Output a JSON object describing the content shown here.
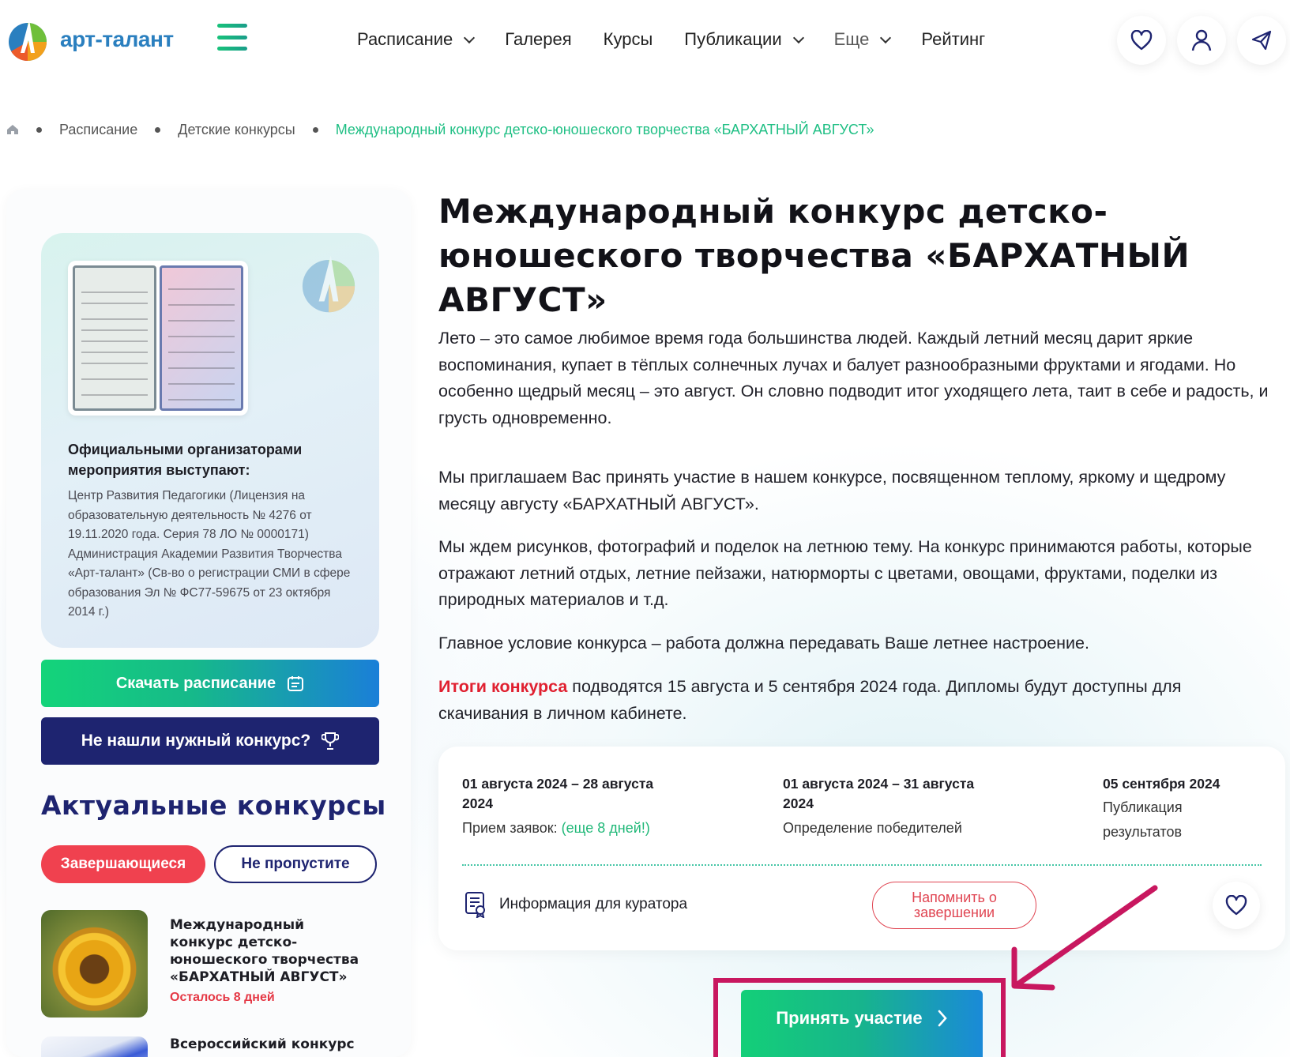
{
  "header": {
    "logo_text": "арт-талант",
    "nav": [
      {
        "label": "Расписание",
        "dropdown": true
      },
      {
        "label": "Галерея",
        "dropdown": false
      },
      {
        "label": "Курсы",
        "dropdown": false
      },
      {
        "label": "Публикации",
        "dropdown": true
      },
      {
        "label": "Еще",
        "dropdown": true
      },
      {
        "label": "Рейтинг",
        "dropdown": false
      }
    ],
    "icons": [
      "heart-icon",
      "user-icon",
      "send-icon"
    ]
  },
  "breadcrumb": {
    "items": [
      "Расписание",
      "Детские конкурсы"
    ],
    "current": "Международный конкурс детско-юношеского творчества «БАРХАТНЫЙ АВГУСТ»"
  },
  "sidebar": {
    "org_title": "Официальными организаторами мероприятия выступают:",
    "org_text": "Центр Развития Педагогики (Лицензия на образовательную деятельность № 4276 от 19.11.2020 года. Серия 78 ЛО № 0000171) Администрация Академии Развития Творчества «Арт-талант» (Св-во о регистрации СМИ в сфере образования Эл № ФС77-59675 от 23 октября 2014 г.)",
    "download_label": "Скачать расписание",
    "notfound_label": "Не нашли нужный конкурс?",
    "actual_title": "Актуальные конкурсы",
    "tabs": [
      "Завершающиеся",
      "Не пропустите"
    ],
    "cards": [
      {
        "title": "Международный конкурс детско-юношеского творчества «БАРХАТНЫЙ АВГУСТ»",
        "left": "Осталось 8 дней"
      },
      {
        "title": "Всероссийский конкурс"
      }
    ]
  },
  "main": {
    "title": "Международный конкурс детско-юношеского творчества «БАРХАТНЫЙ АВГУСТ»",
    "p1": "Лето – это самое любимое время года большинства людей. Каждый летний месяц дарит яркие воспоминания, купает в тёплых солнечных лучах и балует разнообразными фруктами и ягодами. Но особенно щедрый месяц – это август. Он словно подводит итог уходящего лета, таит в себе и радость, и грусть одновременно.",
    "p2": "Мы приглашаем Вас принять участие в нашем конкурсе, посвященном теплому, яркому и щедрому месяцу августу «БАРХАТНЫЙ АВГУСТ».",
    "p3": "Мы ждем рисунков, фотографий и поделок на летнюю тему. На конкурс принимаются работы, которые отражают летний отдых, летние пейзажи, натюрморты с цветами, овощами, фруктами, поделки из природных материалов и т.д.",
    "p4": "Главное условие конкурса – работа должна передавать Ваше летнее настроение.",
    "p5_red": "Итоги конкурса",
    "p5_rest": " подводятся 15 августа и 5 сентября 2024 года. Дипломы будут доступны для скачивания в личном кабинете.",
    "stages": [
      {
        "date": "01 августа 2024 – 28 августа 2024",
        "label": "Прием заявок:",
        "extra": "(еще 8 дней!)"
      },
      {
        "date": "01 августа 2024 – 31 августа 2024",
        "label": "Определение победителей"
      },
      {
        "date": "05 сентября 2024",
        "label": "Публикация результатов"
      }
    ],
    "curator_label": "Информация для куратора",
    "remind_label": "Напомнить о завершении",
    "participate_label": "Принять участие"
  },
  "colors": {
    "accent_green": "#1fbf84",
    "navy": "#1e2470",
    "red": "#e02030",
    "highlight": "#c8175f"
  }
}
